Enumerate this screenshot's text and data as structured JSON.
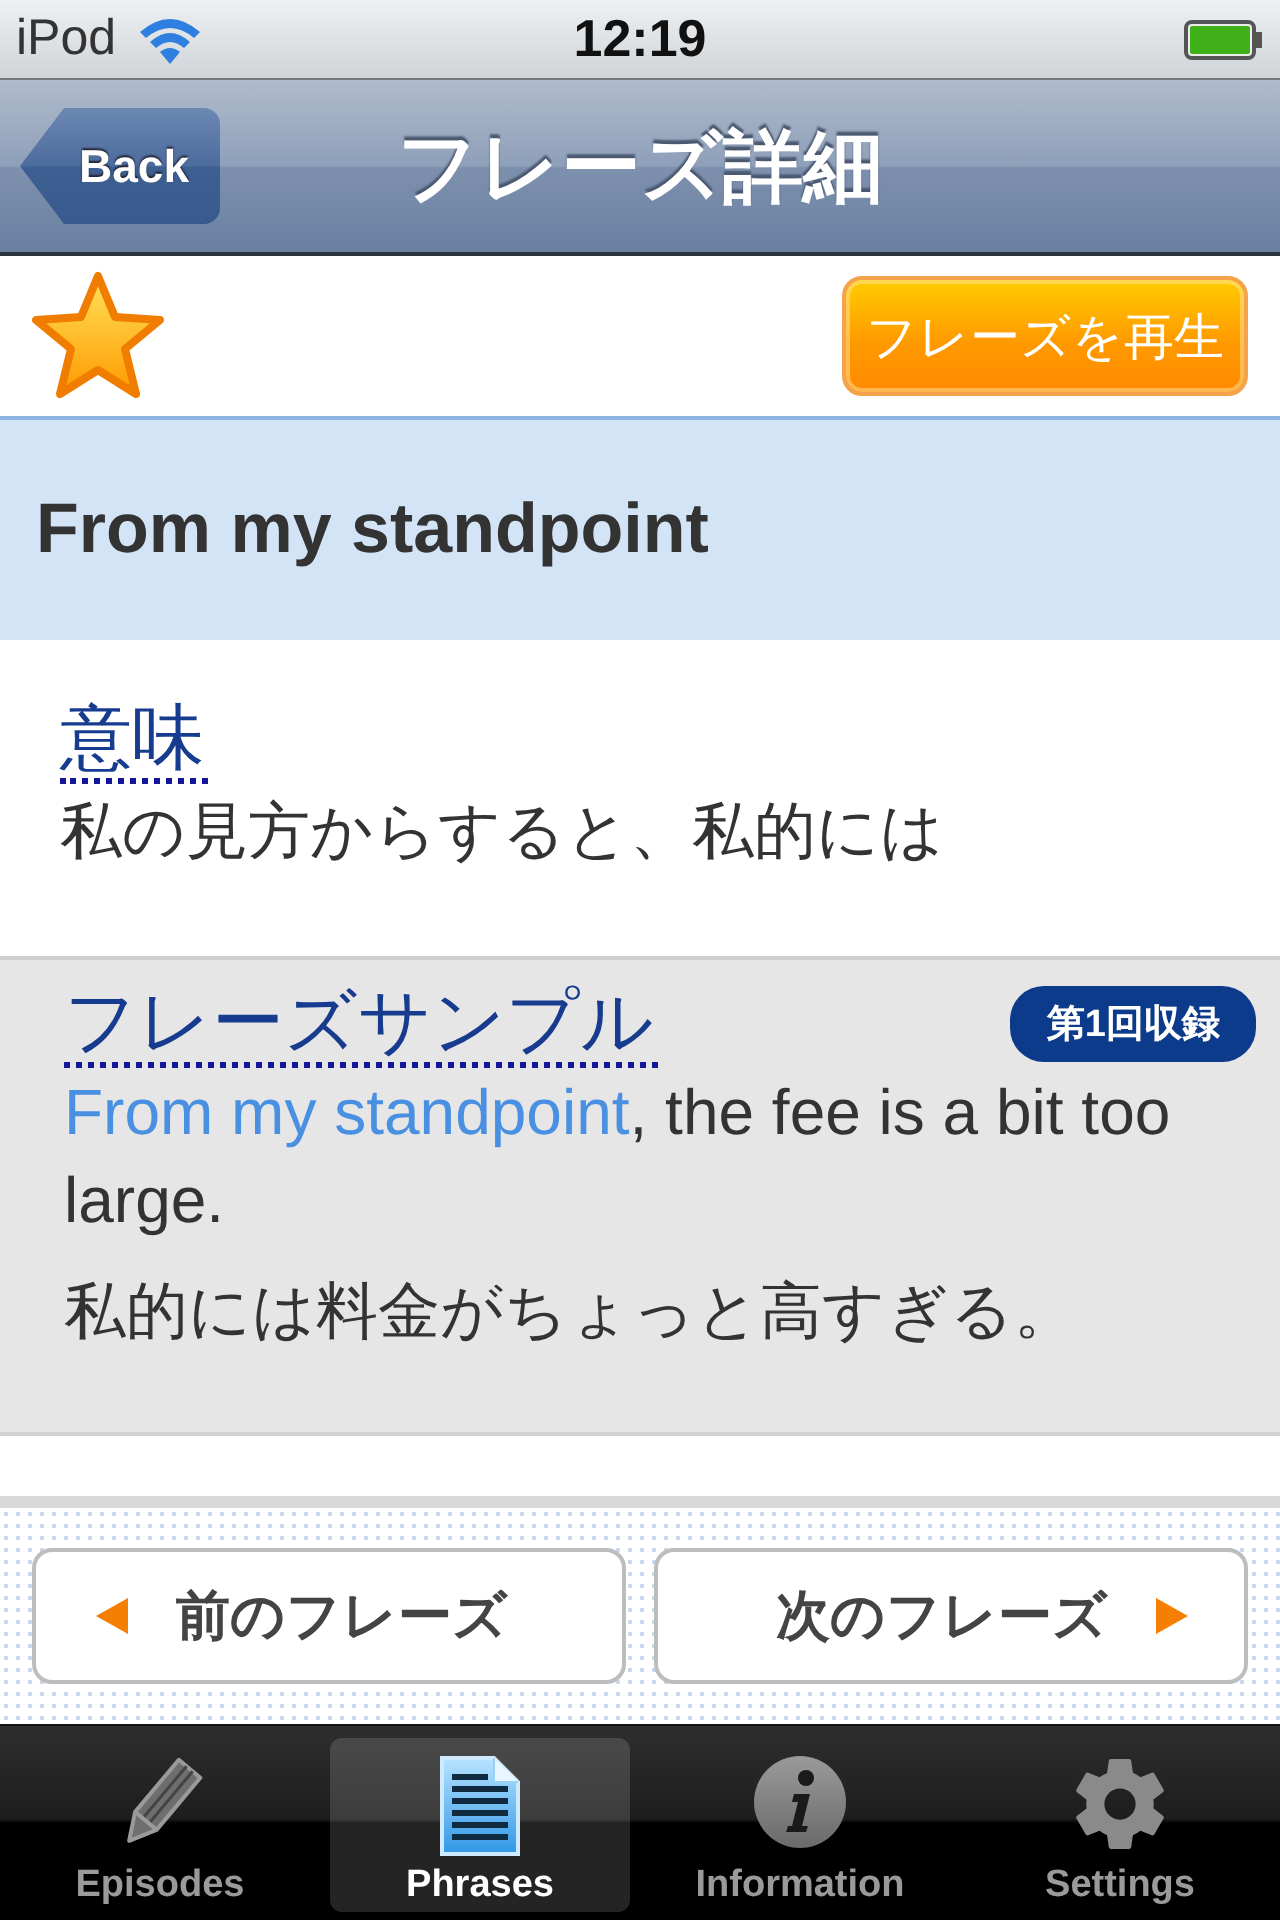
{
  "status_bar": {
    "carrier": "iPod",
    "time": "12:19"
  },
  "nav_bar": {
    "back": "Back",
    "title": "フレーズ詳細"
  },
  "toolbar": {
    "favorite": true,
    "play_button": "フレーズを再生"
  },
  "phrase": "From my standpoint",
  "meaning": {
    "heading": "意味",
    "text": "私の見方からすると、私的には"
  },
  "sample": {
    "heading": "フレーズサンプル",
    "badge": "第1回収録",
    "english": [
      {
        "text": "From my standpoint",
        "highlight": true
      },
      {
        "text": ", the fee is a bit too large.",
        "highlight": false
      }
    ],
    "japanese": "私的には料金がちょっと高すぎる。"
  },
  "pager": [
    {
      "kind": "prev",
      "label": "前のフレーズ"
    },
    {
      "kind": "next",
      "label": "次のフレーズ"
    }
  ],
  "tab_bar": [
    {
      "kind": "pencil",
      "label": "Episodes",
      "selected": false
    },
    {
      "kind": "document",
      "label": "Phrases",
      "selected": true
    },
    {
      "kind": "info",
      "label": "Information",
      "selected": false
    },
    {
      "kind": "gear",
      "label": "Settings",
      "selected": false
    }
  ]
}
